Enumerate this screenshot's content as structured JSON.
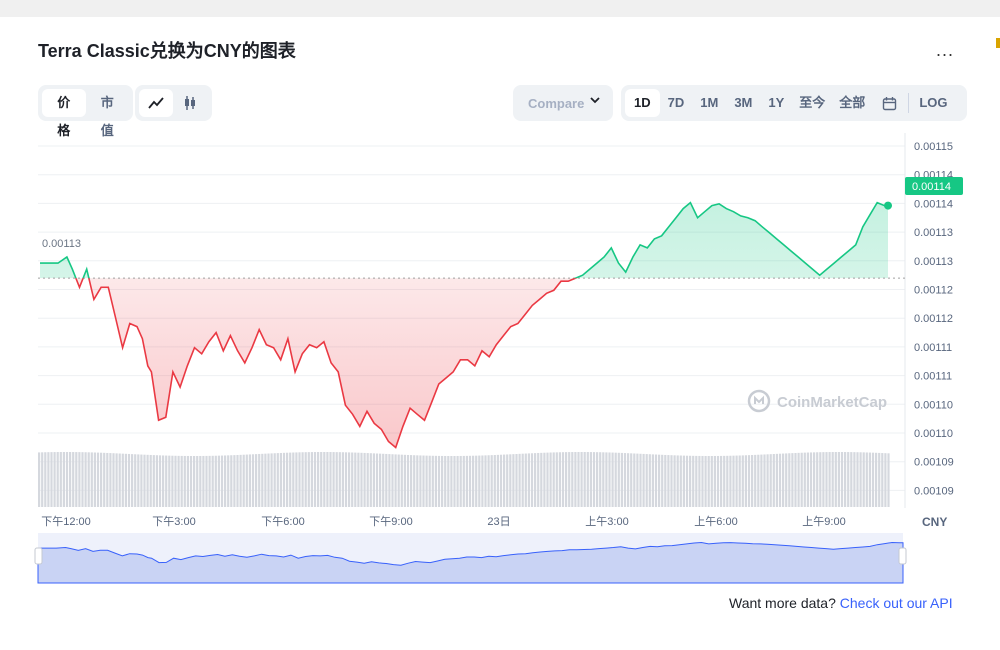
{
  "title": "Terra Classic兑换为CNY的图表",
  "more_label": "...",
  "toggle_metric": [
    {
      "label": "价格",
      "active": true
    },
    {
      "label": "市值",
      "active": false
    }
  ],
  "compare_label": "Compare",
  "ranges": [
    {
      "label": "1D",
      "active": true
    },
    {
      "label": "7D"
    },
    {
      "label": "1M"
    },
    {
      "label": "3M"
    },
    {
      "label": "1Y"
    },
    {
      "label": "至今"
    },
    {
      "label": "全部"
    }
  ],
  "log_label": "LOG",
  "footer": {
    "text": "Want more data?",
    "link": "Check out our API"
  },
  "watermark": "CoinMarketCap",
  "colors": {
    "up": "#16c784",
    "down": "#ea3943",
    "nav": "#3861fb"
  },
  "chart_data": {
    "type": "line",
    "baseline_label": "0.00113",
    "current_label": "0.00114",
    "currency_label": "CNY",
    "y_tick_labels": [
      "0.00115",
      "0.00114",
      "0.00114",
      "0.00113",
      "0.00113",
      "0.00112",
      "0.00112",
      "0.00111",
      "0.00111",
      "0.00110",
      "0.00110",
      "0.00109",
      "0.00109"
    ],
    "x_tick_labels": [
      "下午12:00",
      "下午3:00",
      "下午6:00",
      "下午9:00",
      "23日",
      "上午3:00",
      "上午6:00",
      "上午9:00"
    ],
    "nav_tick_labels": [
      "下午12:00",
      "下午3:00",
      "下午6:00",
      "下午9:00",
      "23日",
      "上午3:00",
      "上午6:00",
      "上午9:00"
    ],
    "ylim": [
      0.001092,
      0.001154
    ],
    "baseline": 0.0011295,
    "series": [
      {
        "x": [
          0,
          0.5,
          0.75,
          0.9,
          1.1,
          1.3,
          1.5,
          1.7,
          1.9,
          2.1,
          2.3,
          2.5,
          2.7,
          2.85,
          3.0,
          3.1,
          3.3,
          3.5,
          3.7,
          3.9,
          4.1,
          4.3,
          4.5,
          4.7,
          4.9,
          5.1,
          5.3,
          5.5,
          5.7,
          5.9,
          6.1,
          6.3,
          6.5,
          6.7,
          6.9,
          7.1,
          7.3,
          7.5,
          7.7,
          7.9,
          8.1,
          8.3,
          8.5,
          8.7,
          8.9,
          9.1,
          9.3,
          9.5,
          9.7,
          9.9,
          10.1,
          10.3,
          10.5,
          10.7,
          10.9,
          11.1,
          11.3,
          11.5,
          11.7,
          11.9,
          12.1,
          12.3,
          12.5,
          12.7,
          12.9,
          13.1,
          13.3,
          13.5,
          13.7,
          13.9,
          14.1,
          14.3,
          14.5,
          14.7,
          14.9,
          15.1,
          15.3,
          15.5,
          15.7,
          15.9,
          16.1,
          16.3,
          16.5,
          16.7,
          16.9,
          17.1,
          17.3,
          17.5,
          17.7,
          17.9,
          18.1,
          18.3,
          18.5,
          18.7,
          18.9,
          19.1,
          19.3,
          19.5,
          19.7,
          19.9,
          20.1,
          20.3,
          20.5,
          20.7,
          20.9,
          21.1,
          21.3,
          21.5,
          21.7,
          21.9,
          22.1,
          22.3,
          22.5,
          22.7,
          22.9,
          23.1,
          23.3,
          23.5,
          23.6
        ],
        "y": [
          0.001132,
          0.001132,
          0.001133,
          0.001131,
          0.001128,
          0.001131,
          0.001126,
          0.001128,
          0.001128,
          0.001123,
          0.001118,
          0.001122,
          0.0011215,
          0.0011195,
          0.001115,
          0.001114,
          0.001106,
          0.0011065,
          0.001114,
          0.0011115,
          0.001115,
          0.001118,
          0.001117,
          0.001119,
          0.0011205,
          0.0011175,
          0.00112,
          0.0011175,
          0.0011155,
          0.001118,
          0.001121,
          0.0011185,
          0.001118,
          0.001116,
          0.0011195,
          0.001114,
          0.001117,
          0.0011185,
          0.001118,
          0.001119,
          0.0011155,
          0.001114,
          0.0011085,
          0.001107,
          0.001105,
          0.0011075,
          0.0011055,
          0.0011045,
          0.0011025,
          0.0011015,
          0.001105,
          0.001108,
          0.001107,
          0.001106,
          0.001109,
          0.001112,
          0.001113,
          0.001114,
          0.001116,
          0.001116,
          0.001115,
          0.0011175,
          0.0011165,
          0.0011185,
          0.00112,
          0.0011215,
          0.001122,
          0.0011235,
          0.001125,
          0.001126,
          0.001127,
          0.0011275,
          0.001129,
          0.001129,
          0.0011295,
          0.00113,
          0.001131,
          0.001132,
          0.001133,
          0.0011345,
          0.001132,
          0.0011305,
          0.001133,
          0.001135,
          0.0011345,
          0.001136,
          0.0011365,
          0.001138,
          0.0011395,
          0.001141,
          0.001142,
          0.0011395,
          0.0011405,
          0.0011415,
          0.0011418,
          0.001141,
          0.0011405,
          0.0011398,
          0.0011395,
          0.001139,
          0.001138,
          0.001137,
          0.001136,
          0.001135,
          0.001134,
          0.001133,
          0.001132,
          0.001131,
          0.00113,
          0.001131,
          0.001132,
          0.001133,
          0.001134,
          0.001135,
          0.001138,
          0.00114,
          0.001142,
          0.0011415,
          0.0011415
        ]
      }
    ]
  }
}
